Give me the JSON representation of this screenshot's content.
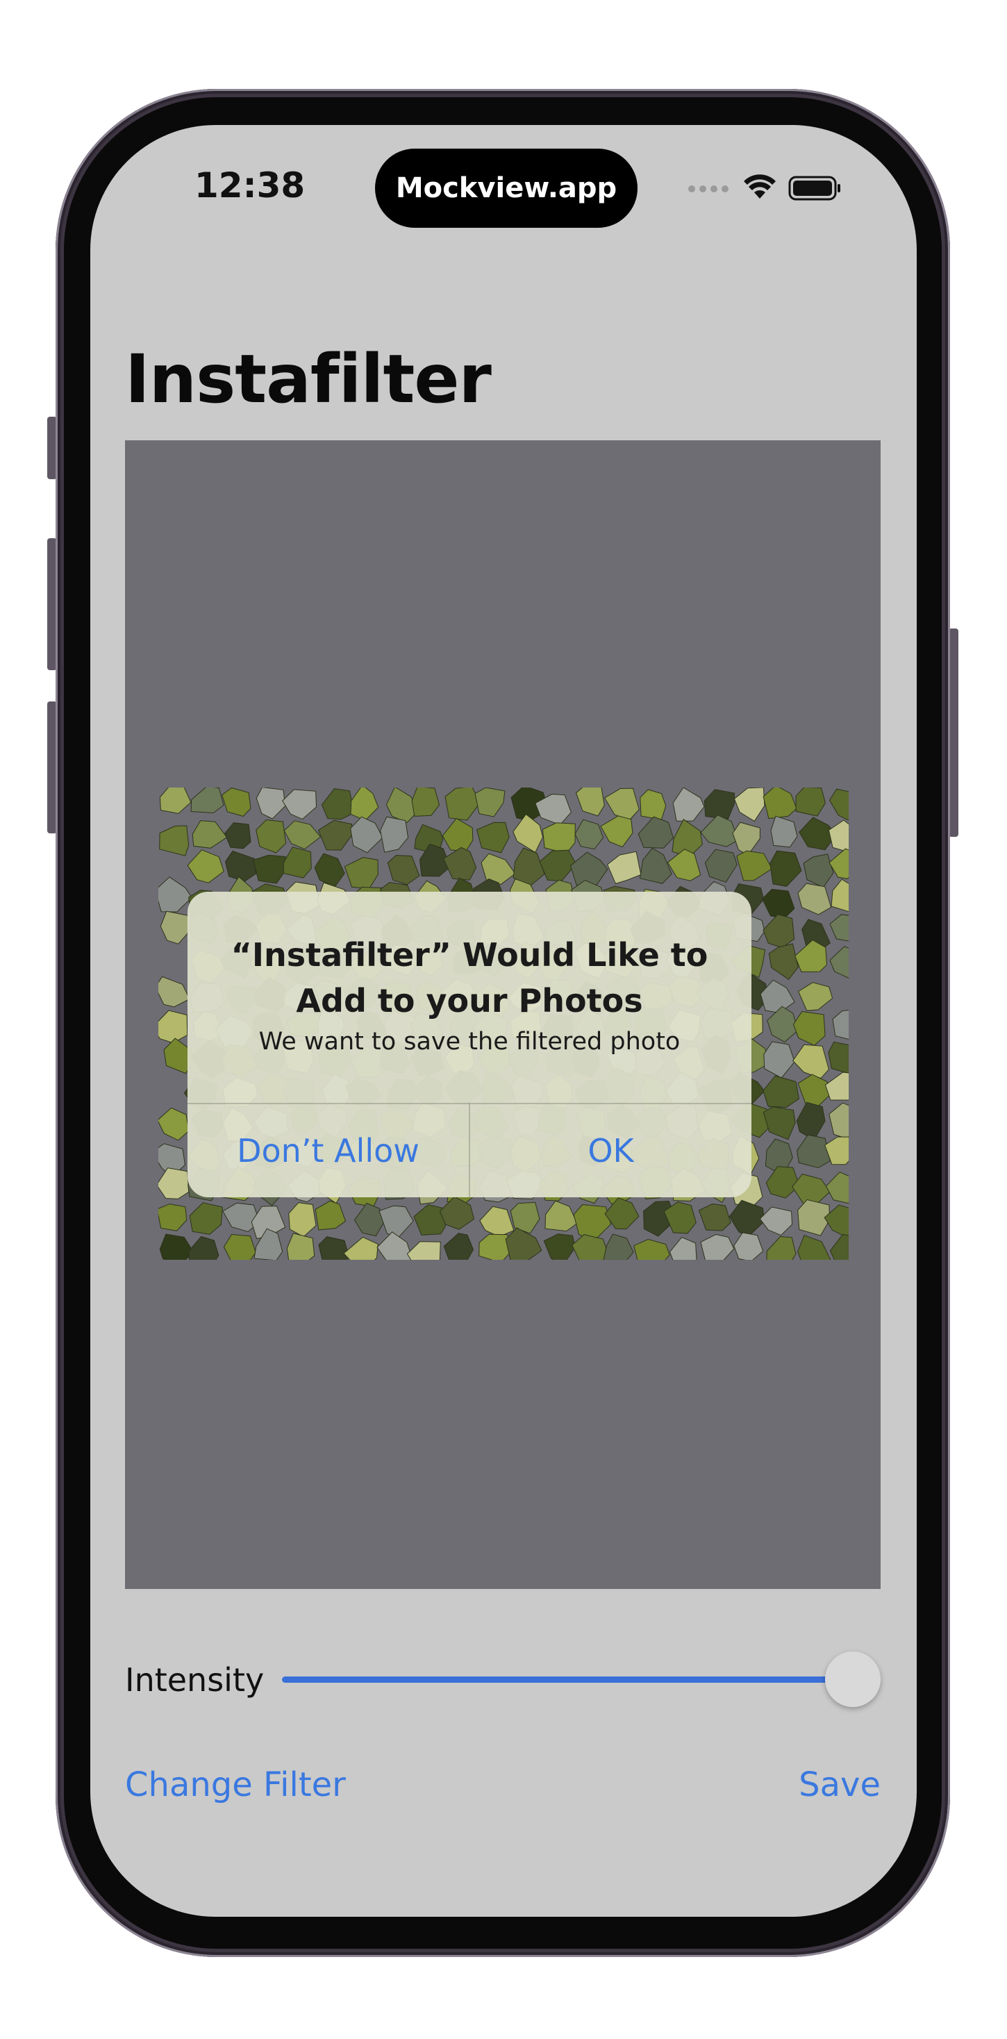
{
  "status_bar": {
    "time": "12:38",
    "island_label": "Mockview.app",
    "icons": [
      "signal-dots-icon",
      "wifi-icon",
      "battery-icon"
    ]
  },
  "page": {
    "title": "Instafilter"
  },
  "alert": {
    "title_line1": "“Instafilter” Would Like to",
    "title_line2": "Add to your Photos",
    "message": "We want to save the filtered photo",
    "deny_label": "Don’t Allow",
    "ok_label": "OK"
  },
  "controls": {
    "intensity_label": "Intensity",
    "intensity_value": 1.0,
    "change_filter_label": "Change Filter",
    "save_label": "Save"
  },
  "colors": {
    "accent": "#3a78e0",
    "screen_background": "#cacaca",
    "canvas_background": "#6e6d73"
  }
}
